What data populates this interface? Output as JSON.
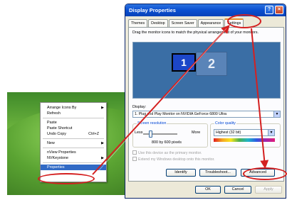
{
  "context_menu": {
    "items": [
      {
        "label": "Arrange Icons By",
        "has_submenu": true
      },
      {
        "label": "Refresh"
      },
      {
        "separator": true
      },
      {
        "label": "Paste"
      },
      {
        "label": "Paste Shortcut"
      },
      {
        "label": "Undo Copy",
        "shortcut": "Ctrl+Z"
      },
      {
        "separator": true
      },
      {
        "label": "New",
        "has_submenu": true
      },
      {
        "separator": true
      },
      {
        "label": "nView Properties"
      },
      {
        "label": "NVKeystone",
        "has_submenu": true
      },
      {
        "separator": true
      },
      {
        "label": "Properties",
        "selected": true
      }
    ]
  },
  "window": {
    "title": "Display Properties",
    "help_button": "?",
    "close_button": "×",
    "tabs": [
      "Themes",
      "Desktop",
      "Screen Saver",
      "Appearance",
      "Settings"
    ],
    "active_tab": "Settings",
    "instruction": "Drag the monitor icons to match the physical arrangement of your monitors.",
    "monitors": [
      "1",
      "2"
    ],
    "display_label": "Display:",
    "display_value": "1. Plug and Play Monitor on NVIDIA GeForce 6800 Ultra",
    "screen_resolution": {
      "legend": "Screen resolution",
      "less": "Less",
      "more": "More",
      "value": "800 by 600 pixels"
    },
    "color_quality": {
      "legend": "Color quality",
      "value": "Highest (32 bit)"
    },
    "checkbox_primary": "Use this device as the primary monitor.",
    "checkbox_extend": "Extend my Windows desktop onto this monitor.",
    "buttons": {
      "identify": "Identify",
      "troubleshoot": "Troubleshoot...",
      "advanced": "Advanced",
      "ok": "OK",
      "cancel": "Cancel",
      "apply": "Apply"
    }
  },
  "colors": {
    "titlebar": "#0a4fd0",
    "callout": "#d42020",
    "active_tab_accent": "#e68b2c",
    "monitor_area": "#3a6ea5"
  }
}
